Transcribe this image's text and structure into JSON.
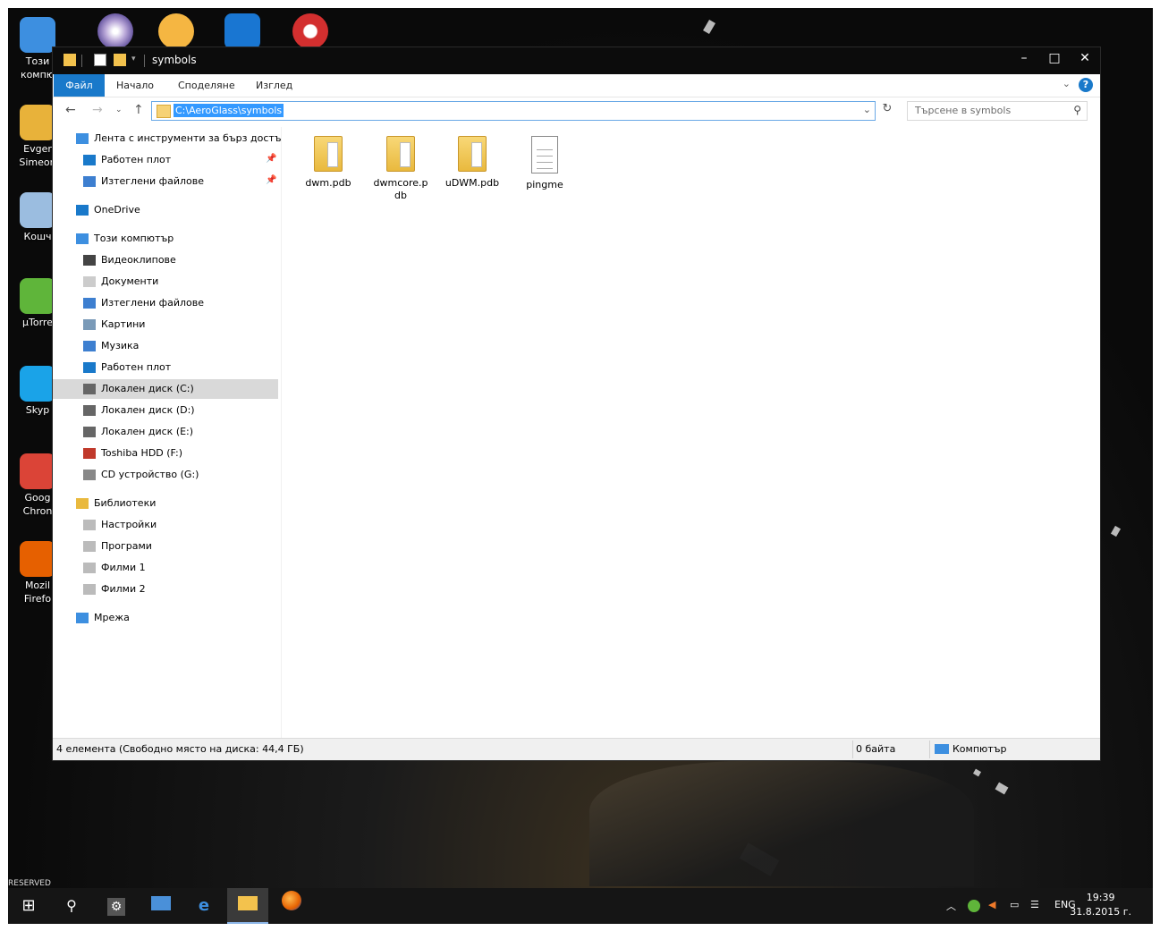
{
  "desktop": {
    "icons": [
      {
        "label": "Този компю",
        "color": "#3d8fe0"
      },
      {
        "label": "Evger Simeon",
        "color": "#e8b23a"
      },
      {
        "label": "Кошч",
        "color": "#9bbde0"
      },
      {
        "label": "µTorre",
        "color": "#5fb53a"
      },
      {
        "label": "Skyp",
        "color": "#1aa3e8"
      },
      {
        "label": "Goog Chron",
        "color": "#db4437"
      },
      {
        "label": "Mozil Firefo",
        "color": "#e66000"
      }
    ],
    "top_icons": [
      "MultiChat",
      "CCleaner"
    ],
    "reserved_text": "RESERVED"
  },
  "window": {
    "title": "symbols",
    "controls": {
      "minimize": "–",
      "maximize": "□",
      "close": "✕"
    }
  },
  "ribbon": {
    "tabs": [
      "Файл",
      "Начало",
      "Споделяне",
      "Изглед"
    ],
    "help": "?"
  },
  "navbar": {
    "address": "C:\\AeroGlass\\symbols",
    "search_placeholder": "Търсене в symbols"
  },
  "nav_pane": [
    {
      "label": "Лента с инструменти за бърз достъп",
      "icon": "star-icon",
      "indent": 0
    },
    {
      "label": "Работен плот",
      "icon": "desktop-icon",
      "indent": 1,
      "pinned": true
    },
    {
      "label": "Изтеглени файлове",
      "icon": "download-icon",
      "indent": 1,
      "pinned": true
    },
    {
      "label": "OneDrive",
      "icon": "cloud-icon",
      "indent": 0
    },
    {
      "label": "Този компютър",
      "icon": "computer-icon",
      "indent": 0
    },
    {
      "label": "Видеоклипове",
      "icon": "video-icon",
      "indent": 1
    },
    {
      "label": "Документи",
      "icon": "document-icon",
      "indent": 1
    },
    {
      "label": "Изтеглени файлове",
      "icon": "download-icon",
      "indent": 1
    },
    {
      "label": "Картини",
      "icon": "pictures-icon",
      "indent": 1
    },
    {
      "label": "Музика",
      "icon": "music-icon",
      "indent": 1
    },
    {
      "label": "Работен плот",
      "icon": "desktop-icon",
      "indent": 1
    },
    {
      "label": "Локален диск (C:)",
      "icon": "drive-icon",
      "indent": 1,
      "selected": true
    },
    {
      "label": "Локален диск (D:)",
      "icon": "drive-icon",
      "indent": 1
    },
    {
      "label": "Локален диск (E:)",
      "icon": "drive-icon",
      "indent": 1
    },
    {
      "label": "Toshiba HDD (F:)",
      "icon": "external-drive-icon",
      "indent": 1
    },
    {
      "label": "CD устройство (G:)",
      "icon": "cd-drive-icon",
      "indent": 1
    },
    {
      "label": "Библиотеки",
      "icon": "library-icon",
      "indent": 0
    },
    {
      "label": "Настройки",
      "icon": "library-item-icon",
      "indent": 1
    },
    {
      "label": "Програми",
      "icon": "library-item-icon",
      "indent": 1
    },
    {
      "label": "Филми 1",
      "icon": "library-item-icon",
      "indent": 1
    },
    {
      "label": "Филми 2",
      "icon": "library-item-icon",
      "indent": 1
    },
    {
      "label": "Мрежа",
      "icon": "network-icon",
      "indent": 0
    }
  ],
  "files": [
    {
      "name": "dwm.pdb",
      "type": "folder"
    },
    {
      "name": "dwmcore.p\ndb",
      "type": "folder"
    },
    {
      "name": "uDWM.pdb",
      "type": "folder"
    },
    {
      "name": "pingme",
      "type": "document"
    }
  ],
  "status": {
    "items": "4 елемента (Свободно място на диска: 44,4 ГБ)",
    "size": "0 байта",
    "location": "Компютър"
  },
  "taskbar": {
    "lang": "ENG",
    "time": "19:39",
    "date": "31.8.2015 г."
  },
  "colors": {
    "accent": "#1979ca",
    "selection": "#3399ff"
  }
}
